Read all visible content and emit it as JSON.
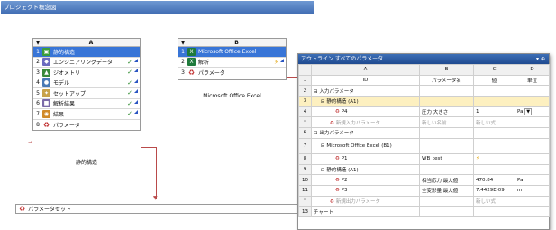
{
  "window": {
    "title": "プロジェクト概念図"
  },
  "system_a": {
    "column": "A",
    "caption": "静的構造",
    "rows": [
      {
        "num": "1",
        "label": "静的構造",
        "icon": "static-structural-icon",
        "status": ""
      },
      {
        "num": "2",
        "label": "エンジニアリングデータ",
        "icon": "engineering-data-icon",
        "status": "✓"
      },
      {
        "num": "3",
        "label": "ジオメトリ",
        "icon": "geometry-icon",
        "status": "✓"
      },
      {
        "num": "4",
        "label": "モデル",
        "icon": "model-icon",
        "status": "✓"
      },
      {
        "num": "5",
        "label": "セットアップ",
        "icon": "setup-icon",
        "status": "✓"
      },
      {
        "num": "6",
        "label": "解析結果",
        "icon": "solution-icon",
        "status": "✓"
      },
      {
        "num": "7",
        "label": "結果",
        "icon": "results-icon",
        "status": "✓"
      },
      {
        "num": "8",
        "label": "パラメータ",
        "icon": "parameter-icon",
        "status": ""
      }
    ]
  },
  "system_b": {
    "column": "B",
    "caption": "Microsoft Office Excel",
    "rows": [
      {
        "num": "1",
        "label": "Microsoft Office Excel",
        "icon": "excel-icon",
        "status": ""
      },
      {
        "num": "2",
        "label": "解析",
        "icon": "analysis-icon",
        "status": "⚡"
      },
      {
        "num": "3",
        "label": "パラメータ",
        "icon": "parameter-icon",
        "status": ""
      }
    ]
  },
  "parameter_set": {
    "label": "パラメータセット"
  },
  "outline": {
    "title": "アウトライン すべてのパラメータ",
    "pin": "▾ ⊕",
    "col_letters": [
      "",
      "A",
      "B",
      "C",
      "D"
    ],
    "col_headers": [
      "1",
      "ID",
      "パラメータ名",
      "値",
      "単位"
    ],
    "rows": [
      {
        "n": "2",
        "id": "⊟ 入力パラメータ",
        "name": "",
        "val": "",
        "unit": ""
      },
      {
        "n": "3",
        "id": "⊟ 静的構造 (A1)",
        "name": "",
        "val": "",
        "unit": ""
      },
      {
        "n": "4",
        "id": "P4",
        "name": "圧力 大きさ",
        "val": "1",
        "unit": "Pa"
      },
      {
        "n": "*",
        "id": "新規入力パラメータ",
        "name": "新しい名前",
        "val": "新しい式",
        "unit": ""
      },
      {
        "n": "6",
        "id": "⊟ 出力パラメータ",
        "name": "",
        "val": "",
        "unit": ""
      },
      {
        "n": "7",
        "id": "⊟ Microsoft Office Excel (B1)",
        "name": "",
        "val": "",
        "unit": ""
      },
      {
        "n": "8",
        "id": "P1",
        "name": "WB_test",
        "val": "⚡",
        "unit": ""
      },
      {
        "n": "9",
        "id": "⊟ 静的構造 (A1)",
        "name": "",
        "val": "",
        "unit": ""
      },
      {
        "n": "10",
        "id": "P2",
        "name": "相当応力 最大値",
        "val": "470.84",
        "unit": "Pa"
      },
      {
        "n": "11",
        "id": "P3",
        "name": "全変形量 最大値",
        "val": "7.4429E-09",
        "unit": "m"
      },
      {
        "n": "*",
        "id": "新規出力パラメータ",
        "name": "",
        "val": "新しい式",
        "unit": ""
      },
      {
        "n": "13",
        "id": "チャート",
        "name": "",
        "val": "",
        "unit": ""
      }
    ]
  }
}
